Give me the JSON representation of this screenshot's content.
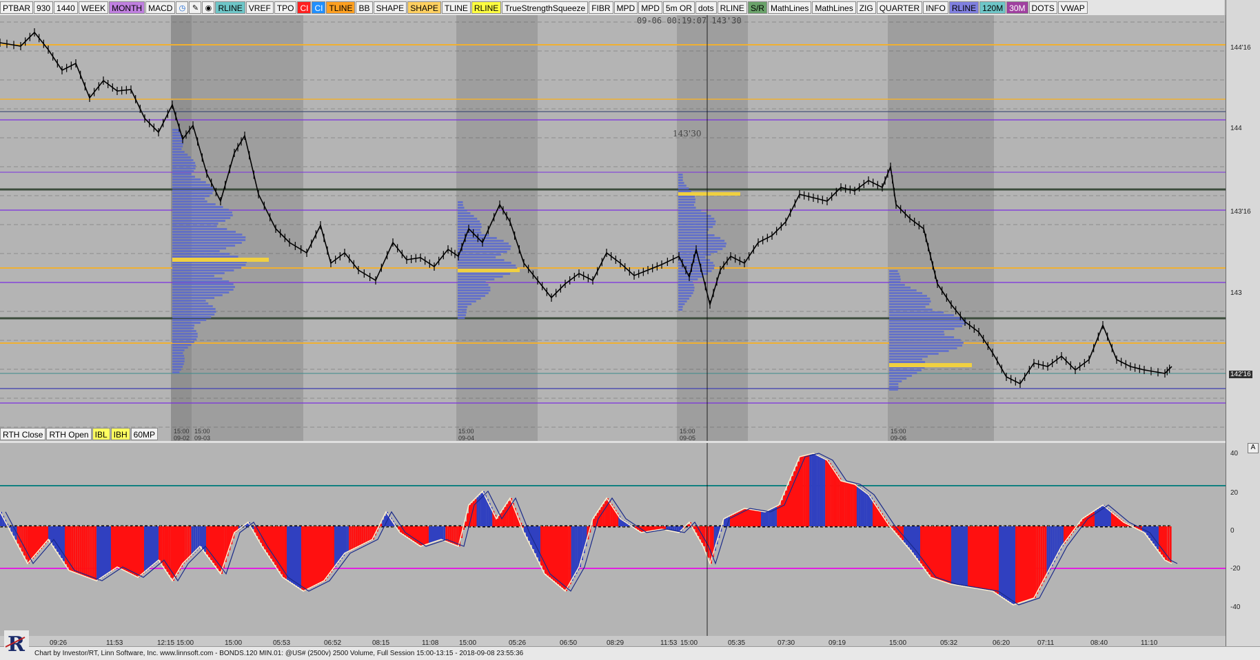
{
  "toolbar": {
    "buttons": [
      {
        "label": "PTBAR",
        "bg": "#f2f2f2"
      },
      {
        "label": "930",
        "bg": "#f2f2f2"
      },
      {
        "label": "1440",
        "bg": "#f2f2f2"
      },
      {
        "label": "WEEK",
        "bg": "#f2f2f2"
      },
      {
        "label": "MONTH",
        "bg": "#c080e0"
      },
      {
        "label": "MACD",
        "bg": "#f2f2f2"
      }
    ],
    "icons": [
      "clock-icon",
      "pencil-icon",
      "eye-icon"
    ],
    "buttons2": [
      {
        "label": "RLINE",
        "bg": "#6ec6c8"
      },
      {
        "label": "VREF",
        "bg": "#f2f2f2"
      },
      {
        "label": "TPO",
        "bg": "#f2f2f2"
      },
      {
        "label": "CI",
        "bg": "#ff2020"
      },
      {
        "label": "CI",
        "bg": "#2090ff"
      },
      {
        "label": "TLINE",
        "bg": "#ffa020"
      },
      {
        "label": "BB",
        "bg": "#f2f2f2"
      },
      {
        "label": "SHAPE",
        "bg": "#f2f2f2"
      },
      {
        "label": "SHAPE",
        "bg": "#ffd060"
      },
      {
        "label": "TLINE",
        "bg": "#f2f2f2"
      },
      {
        "label": "RLINE",
        "bg": "#ffff40"
      },
      {
        "label": "TrueStrengthSqueeze",
        "bg": "#f2f2f2"
      },
      {
        "label": "FIBR",
        "bg": "#f2f2f2"
      },
      {
        "label": "MPD",
        "bg": "#f2f2f2"
      },
      {
        "label": "MPD",
        "bg": "#f2f2f2"
      },
      {
        "label": "5m OR",
        "bg": "#f2f2f2"
      },
      {
        "label": "dots",
        "bg": "#f2f2f2"
      },
      {
        "label": "RLINE",
        "bg": "#f2f2f2"
      },
      {
        "label": "S/R",
        "bg": "#6aa36a"
      },
      {
        "label": "MathLines",
        "bg": "#f2f2f2"
      },
      {
        "label": "MathLines",
        "bg": "#f2f2f2"
      },
      {
        "label": "ZIG",
        "bg": "#f2f2f2"
      },
      {
        "label": "QUARTER",
        "bg": "#f2f2f2"
      },
      {
        "label": "INFO",
        "bg": "#f2f2f2"
      },
      {
        "label": "RLINE",
        "bg": "#8080e0"
      },
      {
        "label": "120M",
        "bg": "#6ec6c8"
      },
      {
        "label": "30M",
        "bg": "#a040a0"
      },
      {
        "label": "DOTS",
        "bg": "#f2f2f2"
      },
      {
        "label": "VWAP",
        "bg": "#f2f2f2"
      }
    ]
  },
  "session_buttons": [
    {
      "label": "RTH Close",
      "bg": "#f2f2f2"
    },
    {
      "label": "RTH Open",
      "bg": "#f2f2f2"
    },
    {
      "label": "IBL",
      "bg": "#ffff60"
    },
    {
      "label": "IBH",
      "bg": "#ffff60"
    },
    {
      "label": "60MP",
      "bg": "#f2f2f2"
    }
  ],
  "crosshair_info": "09-06 00:19:07  143'30",
  "mid_label": "143'30",
  "price_axis": {
    "labels": [
      "144'16",
      "144",
      "143'16",
      "143",
      "142'16"
    ],
    "last_price": "142'16"
  },
  "osc_axis": {
    "labels": [
      "40",
      "20",
      "0",
      "-20",
      "-40"
    ]
  },
  "a_button": "A",
  "time_labels": [
    "09:26",
    "11:53",
    "12:15",
    "15:00",
    "15:00",
    "05:53",
    "06:52",
    "08:15",
    "11:08",
    "15:00",
    "05:26",
    "06:50",
    "08:29",
    "11:53",
    "15:00",
    "05:35",
    "07:30",
    "09:19",
    "15:00",
    "05:32",
    "06:20",
    "07:11",
    "08:40",
    "11:10"
  ],
  "session_labels": [
    {
      "time": "15:00",
      "date": "09-02"
    },
    {
      "time": "15:00",
      "date": "09-03"
    },
    {
      "time": "15:00",
      "date": "09-04"
    },
    {
      "time": "15:00",
      "date": "09-05"
    },
    {
      "time": "15:00",
      "date": "09-06"
    }
  ],
  "footer": "Chart by Investor/RT, Linn Software, Inc. www.linnsoft.com - BONDS.120 MIN.01: @US# (2500v) 2500 Volume, Full Session 15:00-13:15 - 2018-09-08 23:55:36",
  "colors": {
    "bg": "#b4b4b4",
    "session_dark": "#8c8c8c",
    "orange_line": "#f0b030",
    "purple_line": "#7a2ee0",
    "blue_line": "#5050b0",
    "teal_line": "#3a8a8a",
    "dark_line": "#3c4c3c",
    "osc_red": "#ff1010",
    "osc_blue": "#3040c0",
    "osc_magenta": "#e020e0",
    "osc_teal": "#108080"
  }
}
